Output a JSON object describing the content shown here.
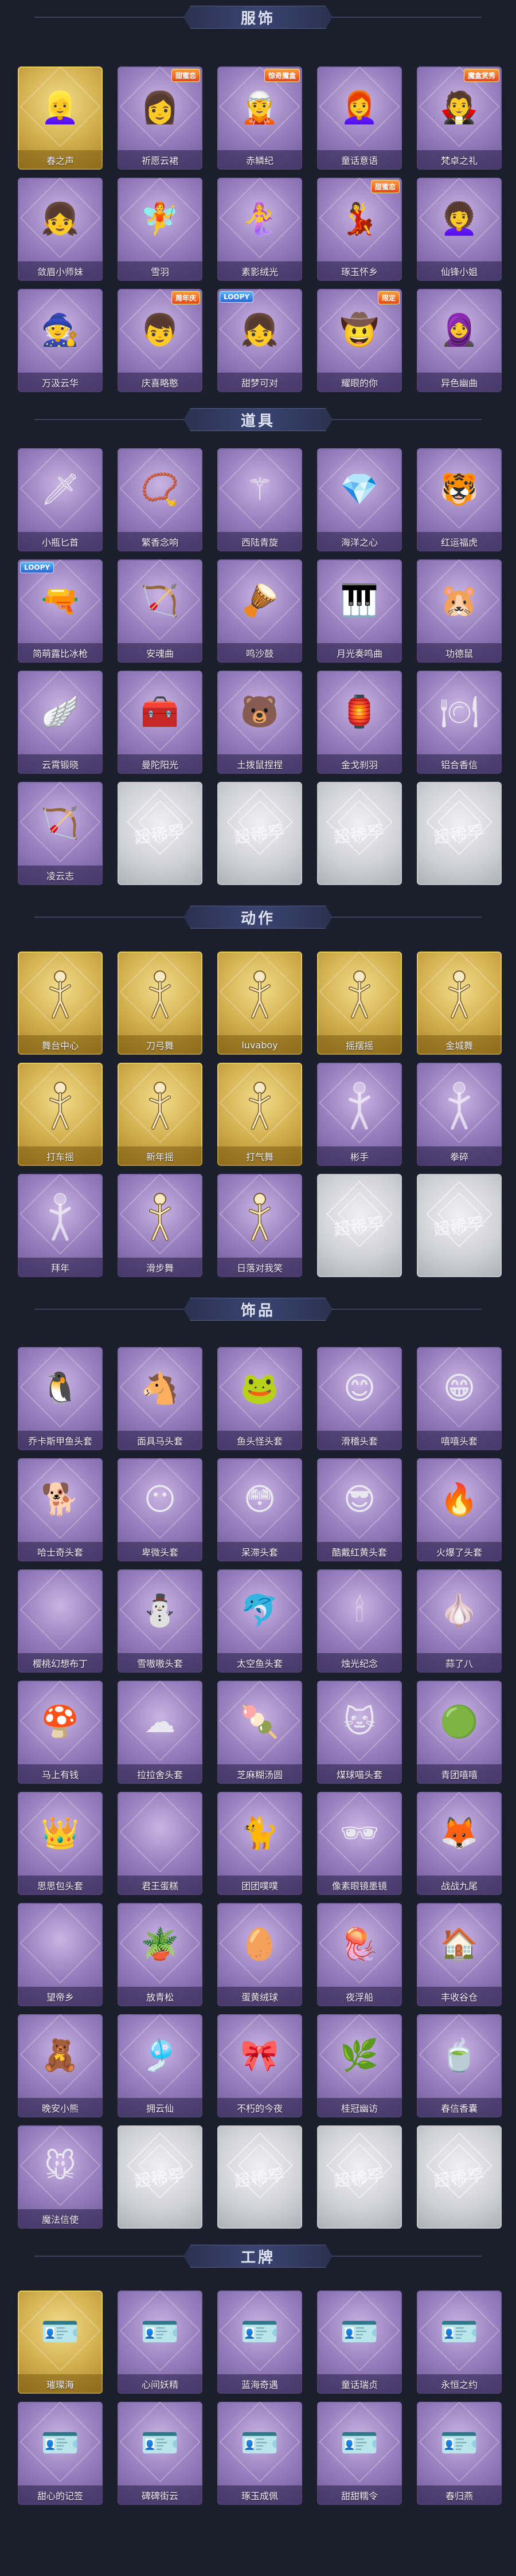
{
  "colors": {
    "page_bg": "#1b1f2c",
    "card_purple": "#9a82c0",
    "card_gold": "#d4b150",
    "card_grey": "#cfd0d6",
    "header_bg": "#3a4470"
  },
  "watermark": "超稀罕",
  "sections": [
    {
      "title": "服饰",
      "items": [
        {
          "label": "春之声",
          "rarity": "gold",
          "icon": "character-blonde-icon"
        },
        {
          "label": "祈愿云裙",
          "rarity": "purple",
          "icon": "character-silver-hair-icon",
          "badge": "甜蜜恋"
        },
        {
          "label": "赤鳞纪",
          "rarity": "purple",
          "icon": "character-green-hood-icon",
          "badge": "惊奇魔盒"
        },
        {
          "label": "童话意语",
          "rarity": "purple",
          "icon": "character-red-hair-icon"
        },
        {
          "label": "梵卓之礼",
          "rarity": "purple",
          "icon": "character-dark-hair-icon",
          "badge": "魔盒赏秀"
        },
        {
          "label": "敛眉小师妹",
          "rarity": "purple",
          "icon": "character-grey-hair-icon"
        },
        {
          "label": "雪羽",
          "rarity": "purple",
          "icon": "character-snow-icon"
        },
        {
          "label": "素影绒光",
          "rarity": "purple",
          "icon": "character-blue-hair-icon"
        },
        {
          "label": "琢玉怀乡",
          "rarity": "purple",
          "icon": "character-purple-hair-icon",
          "badge": "甜蜜恋"
        },
        {
          "label": "仙锋小姐",
          "rarity": "purple",
          "icon": "character-brown-hair-icon"
        },
        {
          "label": "万汲云华",
          "rarity": "purple",
          "icon": "character-white-hair-icon"
        },
        {
          "label": "庆喜略憨",
          "rarity": "purple",
          "icon": "character-festive-icon",
          "badge": "周年庆"
        },
        {
          "label": "甜梦可对",
          "rarity": "purple",
          "icon": "character-pink-icon",
          "badge": "LOOPY"
        },
        {
          "label": "耀眼的你",
          "rarity": "purple",
          "icon": "character-hat-icon",
          "badge": "限定"
        },
        {
          "label": "异色幽曲",
          "rarity": "purple",
          "icon": "character-veil-icon"
        }
      ]
    },
    {
      "title": "道具",
      "items": [
        {
          "label": "小瓶匕首",
          "rarity": "purple",
          "icon": "dagger-icon"
        },
        {
          "label": "繁香念响",
          "rarity": "purple",
          "icon": "beads-icon"
        },
        {
          "label": "西陆青旋",
          "rarity": "purple",
          "icon": "staff-icon"
        },
        {
          "label": "海洋之心",
          "rarity": "purple",
          "icon": "necklace-icon"
        },
        {
          "label": "红运福虎",
          "rarity": "purple",
          "icon": "tiger-icon"
        },
        {
          "label": "简萌露比冰枪",
          "rarity": "purple",
          "icon": "ice-gun-icon",
          "badge": "LOOPY"
        },
        {
          "label": "安魂曲",
          "rarity": "purple",
          "icon": "crossbow-icon"
        },
        {
          "label": "鸣沙鼓",
          "rarity": "purple",
          "icon": "drum-icon"
        },
        {
          "label": "月光奏鸣曲",
          "rarity": "purple",
          "icon": "piano-icon"
        },
        {
          "label": "功德鼠",
          "rarity": "purple",
          "icon": "mouse-icon"
        },
        {
          "label": "云霄锻晓",
          "rarity": "purple",
          "icon": "wings-icon"
        },
        {
          "label": "曼陀阳光",
          "rarity": "purple",
          "icon": "medkit-icon"
        },
        {
          "label": "土拨鼠捏捏",
          "rarity": "purple",
          "icon": "groundhog-icon"
        },
        {
          "label": "金戈刹羽",
          "rarity": "purple",
          "icon": "lantern-icon"
        },
        {
          "label": "铝合香信",
          "rarity": "purple",
          "icon": "plate-icon"
        },
        {
          "label": "凌云志",
          "rarity": "purple",
          "icon": "bow-icon"
        },
        {
          "label": "",
          "rarity": "grey",
          "icon": "locked-icon"
        },
        {
          "label": "",
          "rarity": "grey",
          "icon": "locked-icon"
        },
        {
          "label": "",
          "rarity": "grey",
          "icon": "locked-icon"
        },
        {
          "label": "",
          "rarity": "grey",
          "icon": "locked-icon"
        }
      ]
    },
    {
      "title": "动作",
      "items": [
        {
          "label": "舞台中心",
          "rarity": "gold",
          "icon": "pose-icon"
        },
        {
          "label": "刀弓舞",
          "rarity": "gold",
          "icon": "pose-icon"
        },
        {
          "label": "luvaboy",
          "rarity": "gold",
          "icon": "pose-icon"
        },
        {
          "label": "摇摆摇",
          "rarity": "gold",
          "icon": "pose-icon"
        },
        {
          "label": "金城舞",
          "rarity": "gold",
          "icon": "pose-icon"
        },
        {
          "label": "打车摇",
          "rarity": "gold",
          "icon": "pose-icon"
        },
        {
          "label": "新年摇",
          "rarity": "gold",
          "icon": "pose-icon"
        },
        {
          "label": "打气舞",
          "rarity": "gold",
          "icon": "pose-icon"
        },
        {
          "label": "彬手",
          "rarity": "purple",
          "icon": "pose-faded-icon"
        },
        {
          "label": "拳碎",
          "rarity": "purple",
          "icon": "pose-faded-icon"
        },
        {
          "label": "拜年",
          "rarity": "purple",
          "icon": "pose-faded-icon"
        },
        {
          "label": "滑步舞",
          "rarity": "purple",
          "icon": "pose-icon"
        },
        {
          "label": "日落对我笑",
          "rarity": "purple",
          "icon": "pose-icon"
        },
        {
          "label": "",
          "rarity": "grey",
          "icon": "locked-icon"
        },
        {
          "label": "",
          "rarity": "grey",
          "icon": "locked-icon"
        }
      ]
    },
    {
      "title": "饰品",
      "items": [
        {
          "label": "乔卡斯甲鱼头套",
          "rarity": "purple",
          "icon": "penguin-head-icon"
        },
        {
          "label": "面具马头套",
          "rarity": "purple",
          "icon": "horse-head-icon"
        },
        {
          "label": "鱼头怪头套",
          "rarity": "purple",
          "icon": "fish-head-icon"
        },
        {
          "label": "滑稽头套",
          "rarity": "purple",
          "icon": "smile-face-icon"
        },
        {
          "label": "嘻嘻头套",
          "rarity": "purple",
          "icon": "grin-face-icon"
        },
        {
          "label": "哈士奇头套",
          "rarity": "purple",
          "icon": "dog-head-icon"
        },
        {
          "label": "卑微头套",
          "rarity": "purple",
          "icon": "shy-face-icon"
        },
        {
          "label": "呆滞头套",
          "rarity": "purple",
          "icon": "stare-face-icon"
        },
        {
          "label": "酷戴红黄头套",
          "rarity": "purple",
          "icon": "pikachu-icon"
        },
        {
          "label": "火爆了头套",
          "rarity": "purple",
          "icon": "fire-face-icon"
        },
        {
          "label": "樱桃幻想布丁",
          "rarity": "purple",
          "icon": "blank-icon"
        },
        {
          "label": "雪嗷嗷头套",
          "rarity": "purple",
          "icon": "snowman-icon"
        },
        {
          "label": "太空鱼头套",
          "rarity": "purple",
          "icon": "space-fish-icon"
        },
        {
          "label": "烛光纪念",
          "rarity": "purple",
          "icon": "candle-icon"
        },
        {
          "label": "蒜了八",
          "rarity": "purple",
          "icon": "garlic-icon"
        },
        {
          "label": "马上有钱",
          "rarity": "purple",
          "icon": "mushroom-icon"
        },
        {
          "label": "拉拉舍头套",
          "rarity": "purple",
          "icon": "cloud-face-icon"
        },
        {
          "label": "芝麻糊汤圆",
          "rarity": "purple",
          "icon": "dumpling-icon"
        },
        {
          "label": "煤球喵头套",
          "rarity": "purple",
          "icon": "black-cat-icon"
        },
        {
          "label": "青团嘻嘻",
          "rarity": "purple",
          "icon": "green-bun-icon"
        },
        {
          "label": "思思包头套",
          "rarity": "purple",
          "icon": "bun-crown-icon"
        },
        {
          "label": "君王蛋糕",
          "rarity": "purple",
          "icon": "blank-icon"
        },
        {
          "label": "团团噗噗",
          "rarity": "purple",
          "icon": "cat-bun-icon"
        },
        {
          "label": "像素眼镜墨镜",
          "rarity": "purple",
          "icon": "pixel-glasses-icon"
        },
        {
          "label": "战战九尾",
          "rarity": "purple",
          "icon": "fox-icon"
        },
        {
          "label": "望帝乡",
          "rarity": "purple",
          "icon": "blank-icon"
        },
        {
          "label": "放青松",
          "rarity": "purple",
          "icon": "bonsai-icon"
        },
        {
          "label": "蛋黄绒球",
          "rarity": "purple",
          "icon": "egg-icon"
        },
        {
          "label": "夜浮船",
          "rarity": "purple",
          "icon": "jellyfish-icon"
        },
        {
          "label": "丰收谷仓",
          "rarity": "purple",
          "icon": "barn-icon"
        },
        {
          "label": "晚安小熊",
          "rarity": "purple",
          "icon": "bear-charm-icon"
        },
        {
          "label": "拥云仙",
          "rarity": "purple",
          "icon": "cloud-charm-icon"
        },
        {
          "label": "不朽的今夜",
          "rarity": "purple",
          "icon": "pink-charm-icon"
        },
        {
          "label": "桂冠幽访",
          "rarity": "purple",
          "icon": "laurel-charm-icon"
        },
        {
          "label": "春信香囊",
          "rarity": "purple",
          "icon": "sachet-icon"
        },
        {
          "label": "魔法信使",
          "rarity": "purple",
          "icon": "mouse-charm-icon"
        },
        {
          "label": "",
          "rarity": "grey",
          "icon": "locked-icon"
        },
        {
          "label": "",
          "rarity": "grey",
          "icon": "locked-icon"
        },
        {
          "label": "",
          "rarity": "grey",
          "icon": "locked-icon"
        },
        {
          "label": "",
          "rarity": "grey",
          "icon": "locked-icon"
        }
      ]
    },
    {
      "title": "工牌",
      "items": [
        {
          "label": "璀璨海",
          "rarity": "gold",
          "icon": "badge-card-icon"
        },
        {
          "label": "心间妖精",
          "rarity": "purple",
          "icon": "badge-card-icon"
        },
        {
          "label": "蓝海奇遇",
          "rarity": "purple",
          "icon": "badge-card-icon"
        },
        {
          "label": "童话瑞贞",
          "rarity": "purple",
          "icon": "badge-card-icon"
        },
        {
          "label": "永恒之约",
          "rarity": "purple",
          "icon": "badge-card-icon"
        },
        {
          "label": "甜心的记签",
          "rarity": "purple",
          "icon": "badge-card-icon"
        },
        {
          "label": "碑碑街云",
          "rarity": "purple",
          "icon": "badge-card-icon"
        },
        {
          "label": "琢玉成佩",
          "rarity": "purple",
          "icon": "badge-card-icon"
        },
        {
          "label": "甜甜糯令",
          "rarity": "purple",
          "icon": "badge-card-icon"
        },
        {
          "label": "春归燕",
          "rarity": "purple",
          "icon": "badge-card-icon"
        }
      ]
    }
  ]
}
